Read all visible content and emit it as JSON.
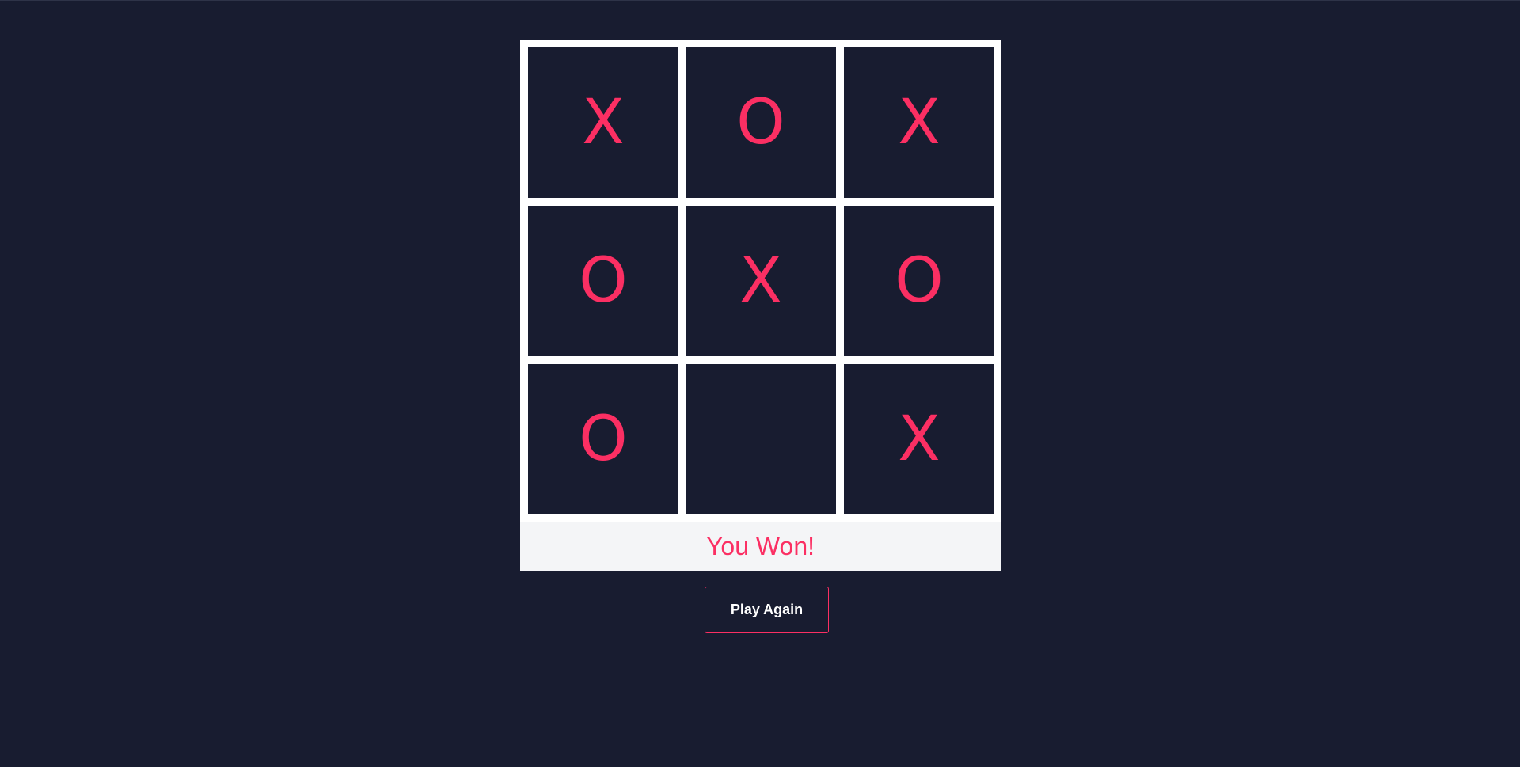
{
  "board": {
    "cells": [
      "X",
      "O",
      "X",
      "O",
      "X",
      "O",
      "O",
      "",
      "X"
    ]
  },
  "status": {
    "message": "You Won!"
  },
  "controls": {
    "play_again_label": "Play Again"
  },
  "colors": {
    "background": "#181c30",
    "grid": "#ffffff",
    "accent": "#fb2f63",
    "status_bar": "#f4f5f7"
  }
}
